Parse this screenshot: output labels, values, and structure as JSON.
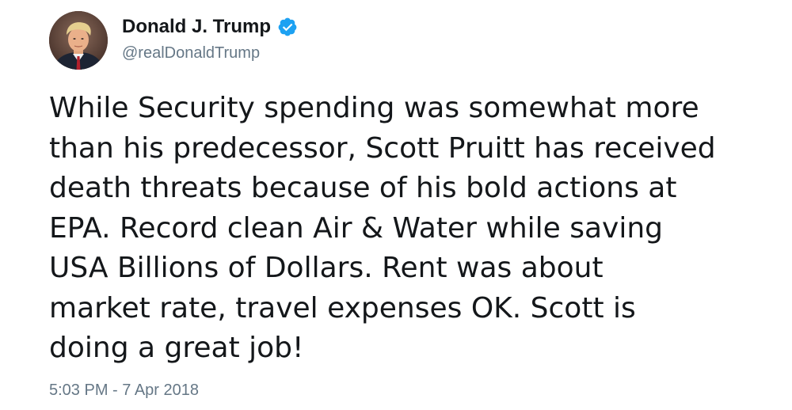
{
  "user": {
    "display_name": "Donald J. Trump",
    "handle": "@realDonaldTrump",
    "verified": true,
    "avatar_icon": "profile-photo-avatar"
  },
  "tweet": {
    "text_lines": [
      "While Security spending was somewhat more",
      "than his predecessor, Scott Pruitt has received",
      "death threats because of his bold actions at",
      "EPA. Record clean Air & Water while saving",
      "USA Billions of Dollars. Rent was about",
      "market rate, travel expenses OK. Scott is",
      "doing a great job!"
    ],
    "timestamp": "5:03 PM - 7 Apr 2018"
  },
  "colors": {
    "text": "#14171a",
    "secondary_text": "#657786",
    "verified_blue": "#1da1f2",
    "background": "#ffffff"
  }
}
